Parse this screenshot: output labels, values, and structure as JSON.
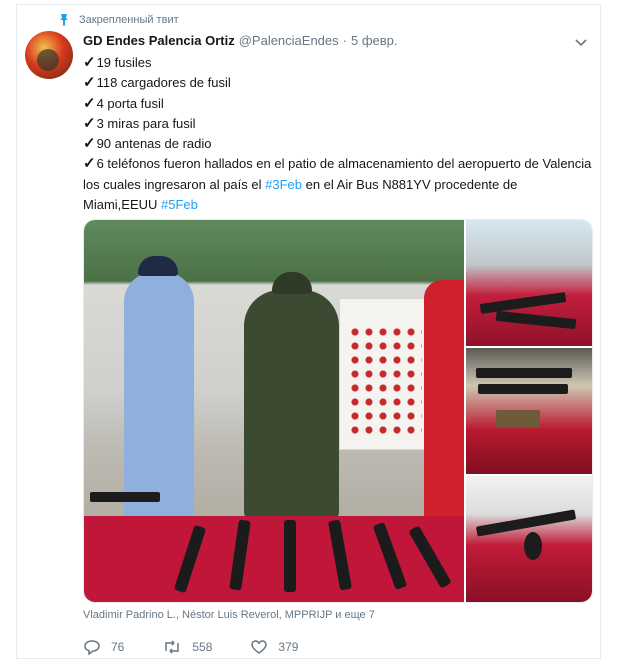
{
  "tweet": {
    "pinned_label": "Закрепленный твит",
    "author_name": "GD Endes Palencia Ortiz",
    "author_handle": "@PalenciaEndes",
    "separator": "·",
    "date": "5 февр.",
    "lines": [
      "19 fusiles",
      "118 cargadores de fusil",
      "4 porta fusil",
      "3 miras para fusil",
      "90 antenas de radio"
    ],
    "check_mark": "✓",
    "last_line_text_1": "6 teléfonos fueron  hallados en el patio de almacenamiento del aeropuerto de Valencia los cuales ingresaron al país el ",
    "hashtag_1": "#3Feb",
    "last_line_text_2": " en el Air Bus N881YV procedente de Miami,EEUU ",
    "hashtag_2": "#5Feb",
    "tagged_users": "Vladimir Padrino L., Néstor Luis Reverol, MPPRIJP и еще 7",
    "replies": "76",
    "retweets": "558",
    "likes": "379"
  },
  "colors": {
    "accent": "#1da1f2",
    "muted": "#657786",
    "text": "#14171a",
    "border": "#e6ecf0"
  },
  "icons": [
    "pin-icon",
    "chevron-down-icon",
    "reply-icon",
    "retweet-icon",
    "like-icon"
  ]
}
